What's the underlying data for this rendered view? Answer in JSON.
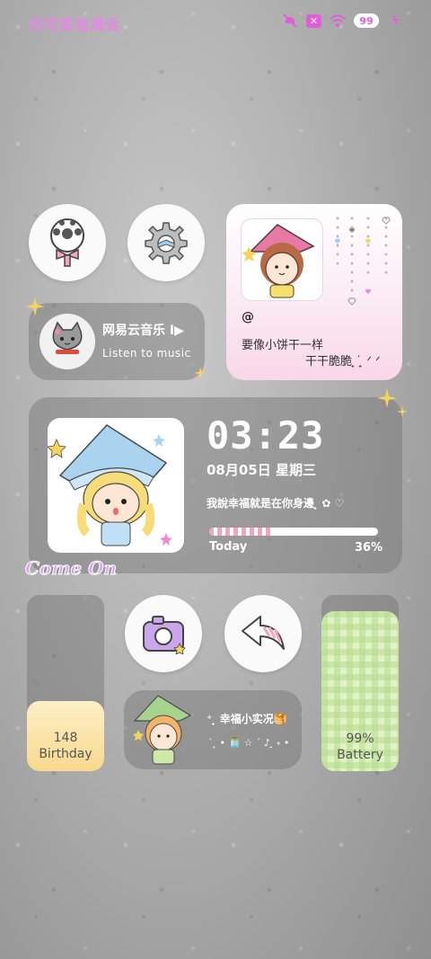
{
  "status_bar": {
    "carrier_text": "仅可紧急通话",
    "battery": "99"
  },
  "music_widget": {
    "title": "网易云音乐 I▶",
    "subtitle": "Listen to music"
  },
  "photo_widget": {
    "handle": "@",
    "line1": "要像小饼干一样",
    "line2": "干干脆脆 ̟ ͘ ̟ ᐟ ᐟ"
  },
  "clock_widget": {
    "time": "03:23",
    "date": "08月05日  星期三",
    "quote": "我說幸福就是在你身邊 ̟ ✿ ♡",
    "progress_label": "Today",
    "progress_percent_text": "36%",
    "progress_value": 0.36
  },
  "decor": {
    "come_on": "Come On"
  },
  "birthday_widget": {
    "count": "148",
    "label": "Birthday"
  },
  "battery_widget": {
    "percent": "99%",
    "label": "Battery"
  },
  "happy_widget": {
    "title": "⁺ ̟ 幸福小实况🥞",
    "line2": "ˋ ̟ • 🫙 ☆ ˊ  ♪ ̟ ˖  •"
  },
  "colors": {
    "accent": "#e05fd8",
    "progress_stripe": "#f2a6bd",
    "birthday_bg": "#f8d98d",
    "battery_bg": "#e2f2c7"
  }
}
